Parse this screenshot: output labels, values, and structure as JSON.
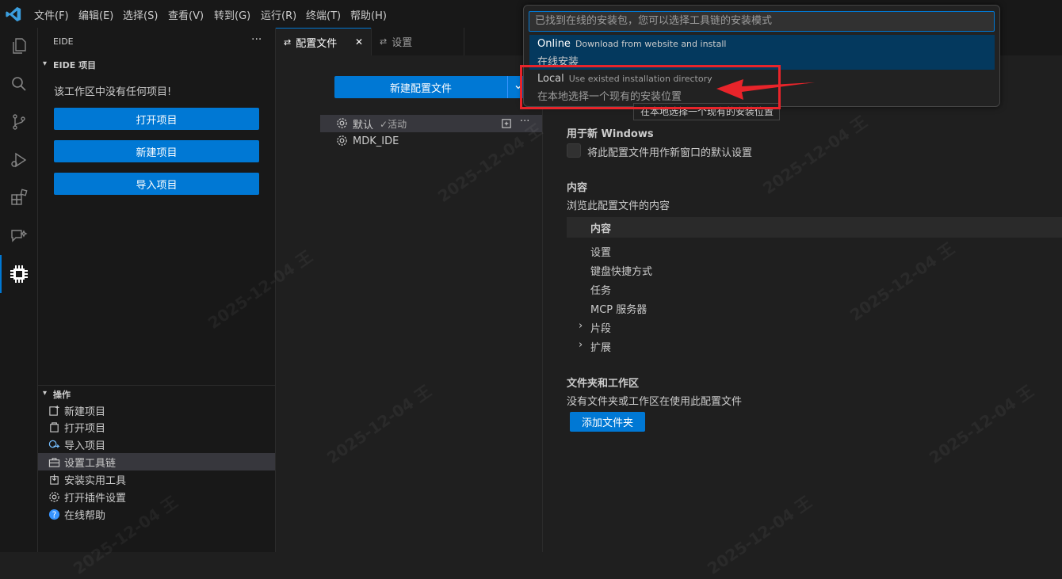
{
  "menu": {
    "items": [
      "文件(F)",
      "编辑(E)",
      "选择(S)",
      "查看(V)",
      "转到(G)",
      "运行(R)",
      "终端(T)",
      "帮助(H)"
    ]
  },
  "activitybar": {
    "icons": [
      "explorer-icon",
      "search-icon",
      "source-control-icon",
      "run-debug-icon",
      "extensions-icon",
      "chat-icon",
      "eide-chip-icon"
    ],
    "active": "eide-chip-icon"
  },
  "sidebar": {
    "title": "EIDE",
    "more": "···",
    "project_section": "EIDE 项目",
    "empty_message": "该工作区中没有任何项目!",
    "buttons": [
      "打开项目",
      "新建项目",
      "导入项目"
    ],
    "actions_section": "操作",
    "actions": [
      {
        "label": "新建项目",
        "icon": "new-project-icon"
      },
      {
        "label": "打开项目",
        "icon": "open-project-icon"
      },
      {
        "label": "导入项目",
        "icon": "import-project-icon"
      },
      {
        "label": "设置工具链",
        "icon": "toolbox-icon"
      },
      {
        "label": "安装实用工具",
        "icon": "install-tools-icon"
      },
      {
        "label": "打开插件设置",
        "icon": "gear-icon"
      },
      {
        "label": "在线帮助",
        "icon": "help-icon"
      }
    ],
    "selected_action": "设置工具链"
  },
  "tabs": [
    {
      "label": "配置文件",
      "icon": "profiles-icon",
      "active": true,
      "close": "✕"
    },
    {
      "label": "设置",
      "icon": "settings-tab-icon",
      "active": false
    }
  ],
  "profiles": {
    "new_button": "新建配置文件",
    "list": [
      {
        "name": "默认",
        "status": "✓活动"
      },
      {
        "name": "MDK_IDE",
        "status": ""
      }
    ]
  },
  "details": {
    "new_windows_header": "用于新 Windows",
    "default_checkbox_label": "将此配置文件用作新窗口的默认设置",
    "contents_header": "内容",
    "contents_desc": "浏览此配置文件的内容",
    "contents_table_header": "内容",
    "contents_items": [
      "设置",
      "键盘快捷方式",
      "任务",
      "MCP 服务器"
    ],
    "contents_expandable": [
      "片段",
      "扩展"
    ],
    "folders_header": "文件夹和工作区",
    "folders_desc": "没有文件夹或工作区在使用此配置文件",
    "add_folder_button": "添加文件夹"
  },
  "quickpick": {
    "placeholder": "已找到在线的安装包，您可以选择工具链的安装模式",
    "items": [
      {
        "label": "Online",
        "description": "Download from website and install",
        "detail": "在线安装"
      },
      {
        "label": "Local",
        "description": "Use existed installation directory",
        "detail": "在本地选择一个现有的安装位置"
      }
    ],
    "tooltip": "在本地选择一个现有的安装位置"
  },
  "watermark": "2025-12-04 王",
  "colors": {
    "accent": "#0078d4",
    "annotation": "#e8242a"
  }
}
